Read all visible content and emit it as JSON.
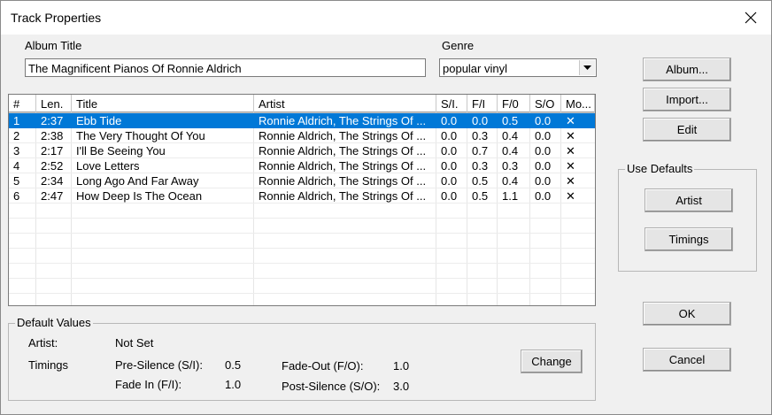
{
  "window": {
    "title": "Track Properties"
  },
  "album": {
    "label": "Album Title",
    "value": "The Magnificent Pianos Of Ronnie Aldrich"
  },
  "genre": {
    "label": "Genre",
    "value": "popular vinyl"
  },
  "table": {
    "columns": [
      "#",
      "Len.",
      "Title",
      "Artist",
      "S/I.",
      "F/I",
      "F/0",
      "S/O",
      "Mo..."
    ],
    "rows": [
      [
        "1",
        "2:37",
        "Ebb Tide",
        "Ronnie Aldrich, The Strings Of ...",
        "0.0",
        "0.0",
        "0.5",
        "0.0",
        "✕"
      ],
      [
        "2",
        "2:38",
        "The Very Thought Of You",
        "Ronnie Aldrich, The Strings Of ...",
        "0.0",
        "0.3",
        "0.4",
        "0.0",
        "✕"
      ],
      [
        "3",
        "2:17",
        "I'll Be Seeing You",
        "Ronnie Aldrich, The Strings Of ...",
        "0.0",
        "0.7",
        "0.4",
        "0.0",
        "✕"
      ],
      [
        "4",
        "2:52",
        "Love Letters",
        "Ronnie Aldrich, The Strings Of ...",
        "0.0",
        "0.3",
        "0.3",
        "0.0",
        "✕"
      ],
      [
        "5",
        "2:34",
        "Long Ago And Far Away",
        "Ronnie Aldrich, The Strings Of ...",
        "0.0",
        "0.5",
        "0.4",
        "0.0",
        "✕"
      ],
      [
        "6",
        "2:47",
        "How Deep Is The Ocean",
        "Ronnie Aldrich, The Strings Of ...",
        "0.0",
        "0.5",
        "1.1",
        "0.0",
        "✕"
      ]
    ],
    "selected_row": 0
  },
  "buttons": {
    "album": "Album...",
    "import": "Import...",
    "edit": "Edit",
    "artist": "Artist",
    "timings": "Timings",
    "ok": "OK",
    "cancel": "Cancel",
    "change": "Change"
  },
  "use_defaults": {
    "title": "Use Defaults"
  },
  "defaults": {
    "title": "Default Values",
    "artist_label": "Artist:",
    "artist_value": "Not Set",
    "timings_label": "Timings",
    "pre_silence_label": "Pre-Silence (S/I):",
    "pre_silence_value": "0.5",
    "fade_in_label": "Fade In (F/I):",
    "fade_in_value": "1.0",
    "fade_out_label": "Fade-Out (F/O):",
    "fade_out_value": "1.0",
    "post_silence_label": "Post-Silence (S/O):",
    "post_silence_value": "3.0"
  },
  "colors": {
    "selection": "#0078d7",
    "dialog_bg": "#f0f0f0"
  },
  "icons": {
    "close": "close-icon",
    "dropdown": "chevron-down-icon"
  }
}
